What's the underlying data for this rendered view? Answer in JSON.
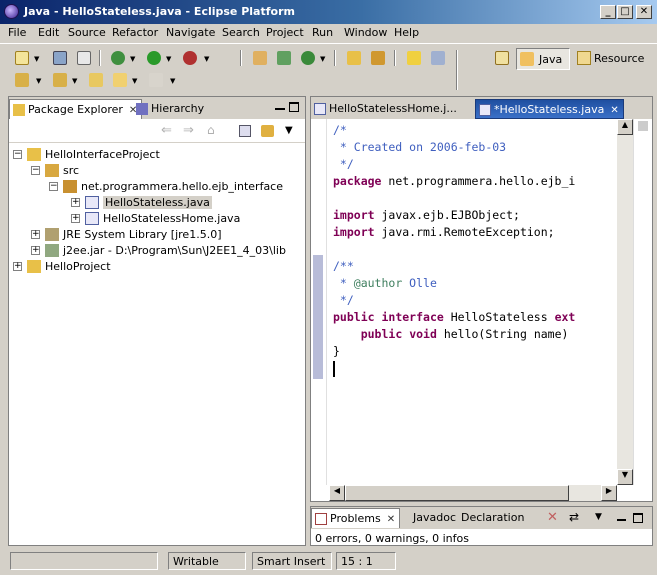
{
  "window": {
    "title": "Java - HelloStateless.java - Eclipse Platform",
    "min": "_",
    "max": "□",
    "close": "✕"
  },
  "menu": [
    "File",
    "Edit",
    "Source",
    "Refactor",
    "Navigate",
    "Search",
    "Project",
    "Run",
    "Window",
    "Help"
  ],
  "perspectives": {
    "java": "Java",
    "resource": "Resource"
  },
  "explorer": {
    "tabs": [
      {
        "label": "Package Explorer",
        "close": "✕"
      },
      {
        "label": "Hierarchy"
      }
    ],
    "tree": [
      {
        "label": "HelloInterfaceProject",
        "level": 0,
        "icon": "project-icon",
        "exp": "−"
      },
      {
        "label": "src",
        "level": 1,
        "icon": "source-folder-icon",
        "exp": "−"
      },
      {
        "label": "net.programmera.hello.ejb_interface",
        "level": 2,
        "icon": "package-icon",
        "exp": "−"
      },
      {
        "label": "HelloStateless.java",
        "level": 3,
        "icon": "java-file-icon",
        "exp": "+",
        "selected": true
      },
      {
        "label": "HelloStatelessHome.java",
        "level": 3,
        "icon": "java-file-icon",
        "exp": "+"
      },
      {
        "label": "JRE System Library [jre1.5.0]",
        "level": 1,
        "icon": "library-icon",
        "exp": "+"
      },
      {
        "label": "j2ee.jar - D:\\Program\\Sun\\J2EE1_4_03\\lib",
        "level": 1,
        "icon": "jar-icon",
        "exp": "+"
      },
      {
        "label": "HelloProject",
        "level": 0,
        "icon": "project-icon",
        "exp": "+"
      }
    ]
  },
  "editor": {
    "tabs": [
      {
        "label": "HelloStatelessHome.j..."
      },
      {
        "label": "*HelloStateless.java",
        "close": "✕"
      }
    ],
    "lines": [
      {
        "t": "/*",
        "c": "cm"
      },
      {
        "t": " * Created on 2006-feb-03",
        "c": "cm"
      },
      {
        "t": " */",
        "c": "cm"
      },
      {
        "parts": [
          [
            "package",
            "kw"
          ],
          [
            " net.programmera.hello.ejb_i",
            ""
          ]
        ]
      },
      {
        "t": ""
      },
      {
        "parts": [
          [
            "import",
            "kw"
          ],
          [
            " javax.ejb.EJBObject;",
            ""
          ]
        ]
      },
      {
        "parts": [
          [
            "import",
            "kw"
          ],
          [
            " java.rmi.RemoteException;",
            ""
          ]
        ]
      },
      {
        "t": ""
      },
      {
        "t": "/**",
        "c": "cm"
      },
      {
        "parts": [
          [
            " * ",
            "cm"
          ],
          [
            "@author",
            "cmtag"
          ],
          [
            " Olle",
            "cm"
          ]
        ]
      },
      {
        "t": " */",
        "c": "cm"
      },
      {
        "parts": [
          [
            "public",
            "kw"
          ],
          [
            " ",
            ""
          ],
          [
            "interface",
            "kw"
          ],
          [
            " HelloStateless ",
            ""
          ],
          [
            "ext",
            "kw"
          ]
        ]
      },
      {
        "parts": [
          [
            "    ",
            ""
          ],
          [
            "public",
            "kw"
          ],
          [
            " ",
            ""
          ],
          [
            "void",
            "kw"
          ],
          [
            " hello(String name)",
            ""
          ]
        ]
      },
      {
        "t": "}"
      },
      {
        "t": ""
      }
    ]
  },
  "problems": {
    "tabs": [
      {
        "label": "Problems",
        "close": "✕"
      },
      {
        "label": "Javadoc"
      },
      {
        "label": "Declaration"
      }
    ],
    "summary": "0 errors, 0 warnings, 0 infos"
  },
  "status": {
    "mode": "Writable",
    "insert": "Smart Insert",
    "pos": "15 : 1"
  }
}
